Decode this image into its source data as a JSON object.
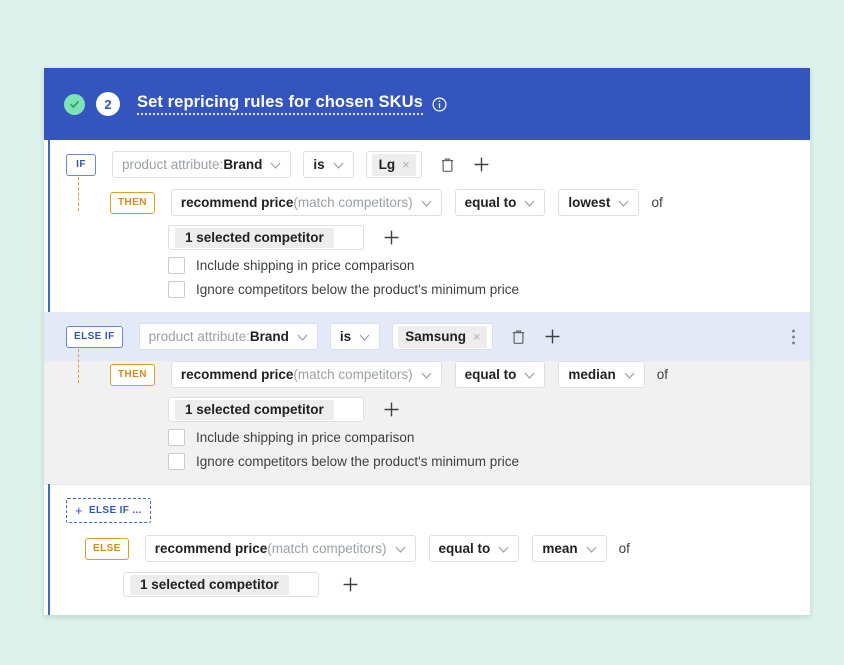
{
  "theme": {
    "page_background": "#ddf2ea",
    "header_blue": "#3355bd",
    "accent_amber": "#d9a12a",
    "success_green": "#7de3b4",
    "highlight_gray": "#f1f1f1",
    "highlight_band": "#e4e9f7"
  },
  "header": {
    "step_number": "2",
    "title": "Set repricing rules for chosen SKUs",
    "check_icon": "check-circle-icon",
    "info_icon": "info-icon"
  },
  "labels": {
    "keyword_if": "IF",
    "keyword_else_if": "ELSE IF",
    "keyword_then": "THEN",
    "keyword_else": "ELSE",
    "of": "of",
    "add_else_if": "+ ELSE IF ...",
    "add_else_if_plus": "+",
    "add_else_if_text": "ELSE IF ...",
    "delete_icon": "trash-icon",
    "add_icon": "plus-icon",
    "more_icon": "kebab-menu-icon",
    "chip_remove_icon": "×",
    "dropdown_icon": "chevron-down-icon"
  },
  "branches": [
    {
      "keyword": "IF",
      "condition": {
        "attribute_prefix": "product attribute: ",
        "attribute_value": "Brand",
        "operator": "is",
        "chips": [
          {
            "label": "Lg"
          }
        ]
      },
      "then": {
        "keyword": "THEN",
        "action_prefix": "recommend price ",
        "action_suffix": "(match competitors)",
        "comparator": "equal to",
        "aggregate": "lowest",
        "of_label": "of",
        "competitors": "1 selected competitor",
        "checkboxes": [
          {
            "label": "Include shipping in price comparison",
            "checked": false
          },
          {
            "label": "Ignore competitors below the product's minimum price",
            "checked": false
          }
        ]
      },
      "highlighted": false,
      "has_menu": false
    },
    {
      "keyword": "ELSE IF",
      "condition": {
        "attribute_prefix": "product attribute: ",
        "attribute_value": "Brand",
        "operator": "is",
        "chips": [
          {
            "label": "Samsung"
          }
        ]
      },
      "then": {
        "keyword": "THEN",
        "action_prefix": "recommend price ",
        "action_suffix": "(match competitors)",
        "comparator": "equal to",
        "aggregate": "median",
        "of_label": "of",
        "competitors": "1 selected competitor",
        "checkboxes": [
          {
            "label": "Include shipping in price comparison",
            "checked": false
          },
          {
            "label": "Ignore competitors below the product's minimum price",
            "checked": false
          }
        ]
      },
      "highlighted": true,
      "has_menu": true
    }
  ],
  "else_branch": {
    "keyword": "ELSE",
    "action_prefix": "recommend price ",
    "action_suffix": "(match competitors)",
    "comparator": "equal to",
    "aggregate": "mean",
    "of_label": "of",
    "competitors": "1 selected competitor"
  }
}
